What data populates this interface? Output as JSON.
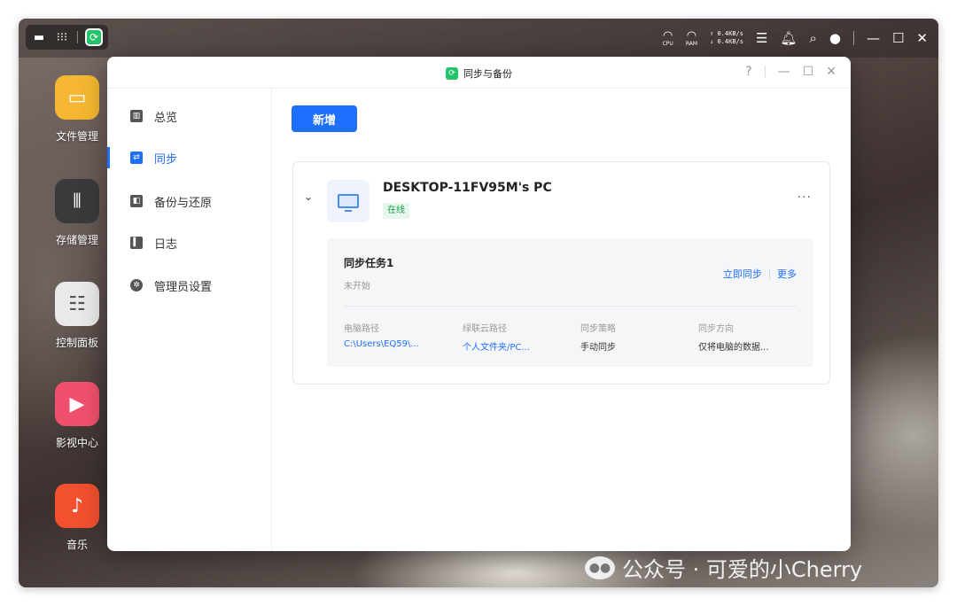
{
  "taskbar": {
    "left_icons": [
      "monitor-icon",
      "apps-grid-icon"
    ],
    "app_icon": "sync-backup-app-icon",
    "cpu_label": "CPU",
    "ram_label": "RAM",
    "net_up": "↑ 0.4KB/s",
    "net_down": "↓ 0.4KB/s",
    "window_controls": [
      "minimize",
      "maximize",
      "close"
    ]
  },
  "dock": {
    "items": [
      {
        "label": "文件管理",
        "icon": "folder-icon",
        "color": "#f5b731"
      },
      {
        "label": "存储管理",
        "icon": "storage-icon",
        "color": "#3a3a3a"
      },
      {
        "label": "控制面板",
        "icon": "sliders-icon",
        "color": "#e9e9e9"
      },
      {
        "label": "影视中心",
        "icon": "video-icon",
        "color": "#f0506e"
      },
      {
        "label": "音乐",
        "icon": "music-icon",
        "color": "#f2502e"
      }
    ]
  },
  "window": {
    "title": "同步与备份",
    "help": "?",
    "colors": {
      "accent": "#1f6fff",
      "success": "#1aa34a"
    }
  },
  "sidebar": {
    "items": [
      {
        "label": "总览",
        "icon": "overview-icon",
        "active": false
      },
      {
        "label": "同步",
        "icon": "sync-icon",
        "active": true
      },
      {
        "label": "备份与还原",
        "icon": "backup-icon",
        "active": false
      },
      {
        "label": "日志",
        "icon": "log-icon",
        "active": false
      },
      {
        "label": "管理员设置",
        "icon": "settings-icon",
        "active": false
      }
    ]
  },
  "main": {
    "add_button": "新增",
    "device": {
      "name": "DESKTOP-11FV95M's PC",
      "status": "在线",
      "more": "···"
    },
    "task": {
      "name": "同步任务1",
      "status": "未开始",
      "sync_now": "立即同步",
      "more": "更多",
      "columns": [
        {
          "header": "电脑路径",
          "value": "C:\\Users\\EQ59\\..."
        },
        {
          "header": "绿联云路径",
          "value": "个人文件夹/PC..."
        },
        {
          "header": "同步策略",
          "value": "手动同步"
        },
        {
          "header": "同步方向",
          "value": "仅将电脑的数据..."
        }
      ]
    }
  },
  "watermark": "公众号 · 可爱的小Cherry"
}
